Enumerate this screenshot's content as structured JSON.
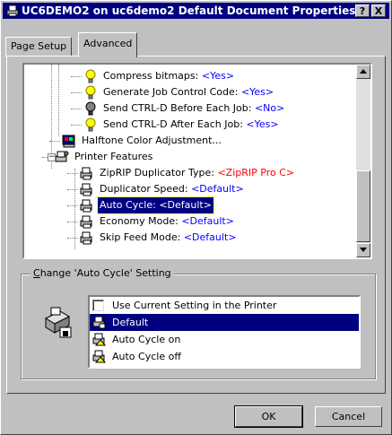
{
  "window": {
    "title": "UC6DEMO2 on uc6demo2 Default Document Properties",
    "help_label": "?",
    "close_label": "X"
  },
  "tabs": [
    {
      "label": "Page Setup",
      "active": false
    },
    {
      "label": "Advanced",
      "active": true
    }
  ],
  "tree": {
    "items": [
      {
        "label": "Compress bitmaps:",
        "value": "<Yes>",
        "icon": "lightbulb-icon"
      },
      {
        "label": "Generate Job Control Code:",
        "value": "<Yes>",
        "icon": "lightbulb-icon"
      },
      {
        "label": "Send CTRL-D Before Each Job:",
        "value": "<No>",
        "icon": "lightbulb-off-icon"
      },
      {
        "label": "Send CTRL-D After Each Job:",
        "value": "<Yes>",
        "icon": "lightbulb-icon"
      },
      {
        "label": "Halftone Color Adjustment...",
        "value": "",
        "icon": "color-adjust-icon"
      },
      {
        "label": "Printer Features",
        "value": "",
        "icon": "printer-features-icon",
        "expander": "−"
      },
      {
        "label": "ZipRIP Duplicator Type:",
        "value": "<ZipRIP Pro C>",
        "icon": "printer-icon"
      },
      {
        "label": "Duplicator Speed:",
        "value": "<Default>",
        "icon": "printer-icon"
      },
      {
        "label": "Auto Cycle:",
        "value": "<Default>",
        "icon": "printer-icon",
        "selected": true
      },
      {
        "label": "Economy Mode:",
        "value": "<Default>",
        "icon": "printer-icon"
      },
      {
        "label": "Skip Feed Mode:",
        "value": "<Default>",
        "icon": "printer-icon"
      }
    ]
  },
  "settings_group": {
    "title_prefix": "C",
    "title_rest": "hange 'Auto Cycle' Setting",
    "options": [
      {
        "label": "Use Current Setting in the Printer",
        "icon": "checkbox-icon"
      },
      {
        "label": "Default",
        "icon": "printer-icon",
        "selected": true
      },
      {
        "label": "Auto Cycle on",
        "icon": "printer-option-icon"
      },
      {
        "label": "Auto Cycle off",
        "icon": "printer-option-icon"
      }
    ]
  },
  "buttons": {
    "ok": "OK",
    "cancel": "Cancel"
  },
  "colors": {
    "titlebar": "#000080",
    "value_text": "#0000ff",
    "value_red": "#ff0000",
    "selection": "#000080"
  }
}
